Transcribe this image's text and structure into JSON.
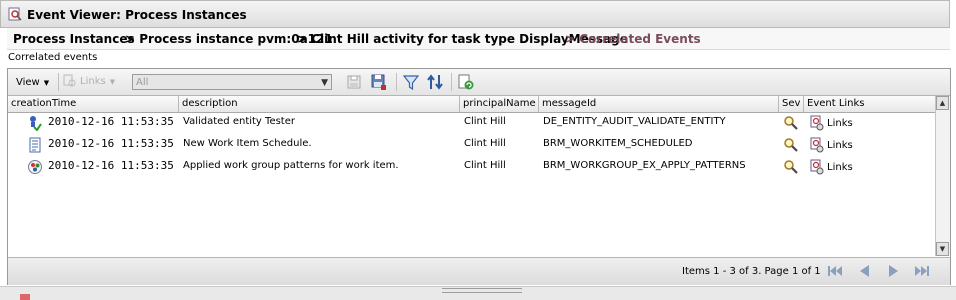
{
  "window": {
    "title": "Event Viewer: Process Instances"
  },
  "breadcrumb": [
    "Process Instances",
    "> Process instance pvm:0a121",
    "> Clint Hill activity for task type DisplayMessage",
    "> Correlated Events"
  ],
  "subtitle": "Correlated events",
  "toolbar": {
    "view_label": "View",
    "links_label": "Links",
    "filter_select": {
      "value": "All"
    },
    "icons": [
      "save-as-icon",
      "save-icon",
      "filter-icon",
      "sort-icon",
      "export-icon"
    ]
  },
  "columns": [
    "creationTime",
    "description",
    "principalName",
    "messageId",
    "Sev",
    "Event Links"
  ],
  "rows": [
    {
      "icon": "validate-entity-icon",
      "time": "2010-12-16 11:53:35",
      "description": "Validated entity Tester",
      "principal": "Clint Hill",
      "messageId": "DE_ENTITY_AUDIT_VALIDATE_ENTITY",
      "links": "Links"
    },
    {
      "icon": "work-item-icon",
      "time": "2010-12-16 11:53:35",
      "description": "New Work Item Schedule.",
      "principal": "Clint Hill",
      "messageId": "BRM_WORKITEM_SCHEDULED",
      "links": "Links"
    },
    {
      "icon": "work-group-icon",
      "time": "2010-12-16 11:53:35",
      "description": "Applied work group patterns for work item.",
      "principal": "Clint Hill",
      "messageId": "BRM_WORKGROUP_EX_APPLY_PATTERNS",
      "links": "Links"
    }
  ],
  "pagination": {
    "info": "Items 1 - 3 of 3. Page 1 of 1"
  },
  "colors": {
    "breadcrumb_current": "#7b4a5c",
    "nav_arrows": "#8aa0c0"
  }
}
